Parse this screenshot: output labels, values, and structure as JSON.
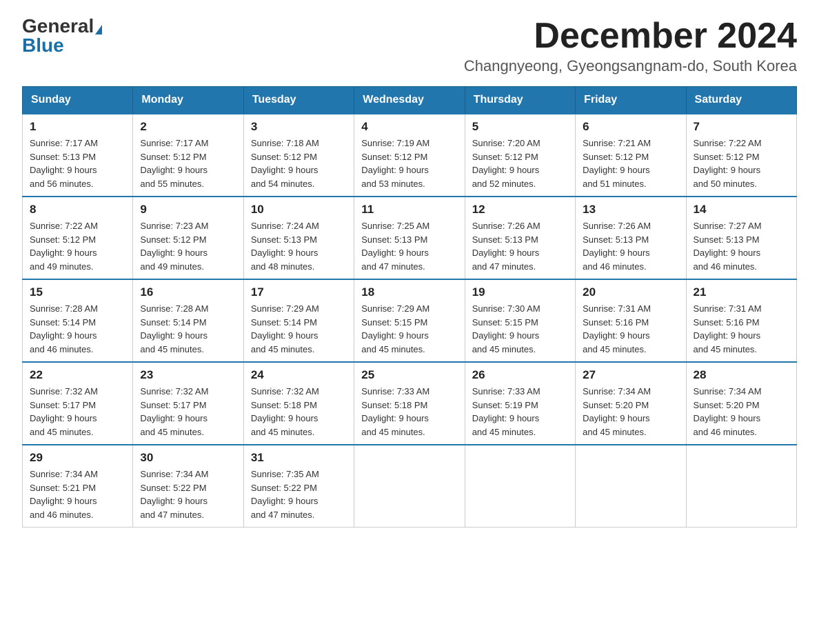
{
  "logo": {
    "general": "General",
    "blue": "Blue"
  },
  "title": "December 2024",
  "location": "Changnyeong, Gyeongsangnam-do, South Korea",
  "days_of_week": [
    "Sunday",
    "Monday",
    "Tuesday",
    "Wednesday",
    "Thursday",
    "Friday",
    "Saturday"
  ],
  "weeks": [
    [
      {
        "day": "1",
        "sunrise": "7:17 AM",
        "sunset": "5:13 PM",
        "daylight": "9 hours and 56 minutes."
      },
      {
        "day": "2",
        "sunrise": "7:17 AM",
        "sunset": "5:12 PM",
        "daylight": "9 hours and 55 minutes."
      },
      {
        "day": "3",
        "sunrise": "7:18 AM",
        "sunset": "5:12 PM",
        "daylight": "9 hours and 54 minutes."
      },
      {
        "day": "4",
        "sunrise": "7:19 AM",
        "sunset": "5:12 PM",
        "daylight": "9 hours and 53 minutes."
      },
      {
        "day": "5",
        "sunrise": "7:20 AM",
        "sunset": "5:12 PM",
        "daylight": "9 hours and 52 minutes."
      },
      {
        "day": "6",
        "sunrise": "7:21 AM",
        "sunset": "5:12 PM",
        "daylight": "9 hours and 51 minutes."
      },
      {
        "day": "7",
        "sunrise": "7:22 AM",
        "sunset": "5:12 PM",
        "daylight": "9 hours and 50 minutes."
      }
    ],
    [
      {
        "day": "8",
        "sunrise": "7:22 AM",
        "sunset": "5:12 PM",
        "daylight": "9 hours and 49 minutes."
      },
      {
        "day": "9",
        "sunrise": "7:23 AM",
        "sunset": "5:12 PM",
        "daylight": "9 hours and 49 minutes."
      },
      {
        "day": "10",
        "sunrise": "7:24 AM",
        "sunset": "5:13 PM",
        "daylight": "9 hours and 48 minutes."
      },
      {
        "day": "11",
        "sunrise": "7:25 AM",
        "sunset": "5:13 PM",
        "daylight": "9 hours and 47 minutes."
      },
      {
        "day": "12",
        "sunrise": "7:26 AM",
        "sunset": "5:13 PM",
        "daylight": "9 hours and 47 minutes."
      },
      {
        "day": "13",
        "sunrise": "7:26 AM",
        "sunset": "5:13 PM",
        "daylight": "9 hours and 46 minutes."
      },
      {
        "day": "14",
        "sunrise": "7:27 AM",
        "sunset": "5:13 PM",
        "daylight": "9 hours and 46 minutes."
      }
    ],
    [
      {
        "day": "15",
        "sunrise": "7:28 AM",
        "sunset": "5:14 PM",
        "daylight": "9 hours and 46 minutes."
      },
      {
        "day": "16",
        "sunrise": "7:28 AM",
        "sunset": "5:14 PM",
        "daylight": "9 hours and 45 minutes."
      },
      {
        "day": "17",
        "sunrise": "7:29 AM",
        "sunset": "5:14 PM",
        "daylight": "9 hours and 45 minutes."
      },
      {
        "day": "18",
        "sunrise": "7:29 AM",
        "sunset": "5:15 PM",
        "daylight": "9 hours and 45 minutes."
      },
      {
        "day": "19",
        "sunrise": "7:30 AM",
        "sunset": "5:15 PM",
        "daylight": "9 hours and 45 minutes."
      },
      {
        "day": "20",
        "sunrise": "7:31 AM",
        "sunset": "5:16 PM",
        "daylight": "9 hours and 45 minutes."
      },
      {
        "day": "21",
        "sunrise": "7:31 AM",
        "sunset": "5:16 PM",
        "daylight": "9 hours and 45 minutes."
      }
    ],
    [
      {
        "day": "22",
        "sunrise": "7:32 AM",
        "sunset": "5:17 PM",
        "daylight": "9 hours and 45 minutes."
      },
      {
        "day": "23",
        "sunrise": "7:32 AM",
        "sunset": "5:17 PM",
        "daylight": "9 hours and 45 minutes."
      },
      {
        "day": "24",
        "sunrise": "7:32 AM",
        "sunset": "5:18 PM",
        "daylight": "9 hours and 45 minutes."
      },
      {
        "day": "25",
        "sunrise": "7:33 AM",
        "sunset": "5:18 PM",
        "daylight": "9 hours and 45 minutes."
      },
      {
        "day": "26",
        "sunrise": "7:33 AM",
        "sunset": "5:19 PM",
        "daylight": "9 hours and 45 minutes."
      },
      {
        "day": "27",
        "sunrise": "7:34 AM",
        "sunset": "5:20 PM",
        "daylight": "9 hours and 45 minutes."
      },
      {
        "day": "28",
        "sunrise": "7:34 AM",
        "sunset": "5:20 PM",
        "daylight": "9 hours and 46 minutes."
      }
    ],
    [
      {
        "day": "29",
        "sunrise": "7:34 AM",
        "sunset": "5:21 PM",
        "daylight": "9 hours and 46 minutes."
      },
      {
        "day": "30",
        "sunrise": "7:34 AM",
        "sunset": "5:22 PM",
        "daylight": "9 hours and 47 minutes."
      },
      {
        "day": "31",
        "sunrise": "7:35 AM",
        "sunset": "5:22 PM",
        "daylight": "9 hours and 47 minutes."
      },
      null,
      null,
      null,
      null
    ]
  ],
  "labels": {
    "sunrise": "Sunrise:",
    "sunset": "Sunset:",
    "daylight": "Daylight: 9 hours"
  }
}
